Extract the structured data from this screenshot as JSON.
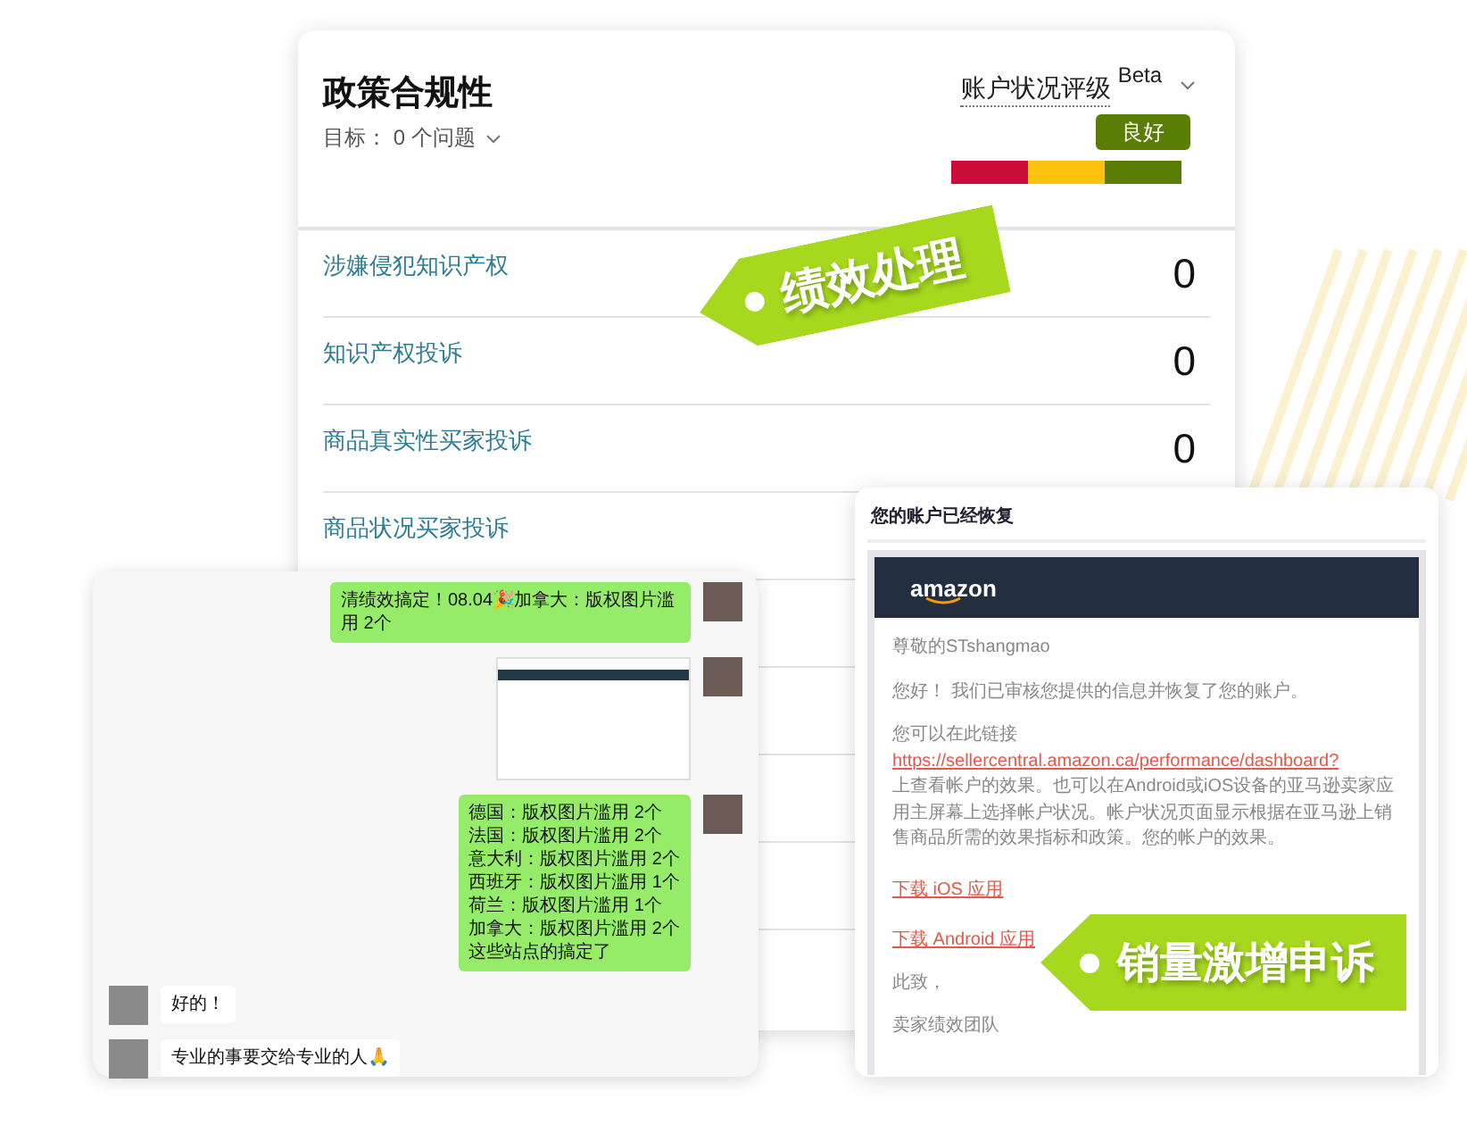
{
  "compliance": {
    "title": "政策合规性",
    "goal": "目标： 0 个问题",
    "rating_label": "账户状况评级",
    "badge": "Beta",
    "status": "良好",
    "gauge": [
      {
        "color": "#cc0c39",
        "selected": false
      },
      {
        "color": "#ffc20e",
        "selected": false
      },
      {
        "color": "#5a7d04",
        "selected": true
      }
    ],
    "rows": [
      {
        "label": "涉嫌侵犯知识产权",
        "count": "0"
      },
      {
        "label": "知识产权投诉",
        "count": "0"
      },
      {
        "label": "商品真实性买家投诉",
        "count": "0"
      },
      {
        "label": "商品状况买家投诉"
      }
    ]
  },
  "chat": {
    "messages": [
      {
        "kind": "sent",
        "text": "清绩效搞定！08.04🎉加拿大：版权图片滥用 2个"
      },
      {
        "kind": "image"
      },
      {
        "kind": "sent",
        "lines": [
          "德国：版权图片滥用 2个",
          "法国：版权图片滥用 2个",
          "意大利：版权图片滥用 2个",
          "西班牙：版权图片滥用 1个",
          "荷兰：版权图片滥用 1个",
          "加拿大：版权图片滥用 2个",
          "这些站点的搞定了"
        ]
      },
      {
        "kind": "received",
        "text": "好的！"
      },
      {
        "kind": "received",
        "text": "专业的事要交给专业的人🙏"
      }
    ]
  },
  "email": {
    "title": "您的账户已经恢复",
    "logo": "amazon",
    "greeting": "尊敬的STshangmao",
    "intro": "您好！ 我们已审核您提供的信息并恢复了您的账户。",
    "body_before_link": "您可以在此链接",
    "link": "https://sellercentral.amazon.ca/performance/dashboard?",
    "body_after_link": "上查看帐户的效果。也可以在Android或iOS设备的亚马逊卖家应用主屏幕上选择帐户状况。帐户状况页面显示根据在亚马逊上销售商品所需的效果指标和政策。您的帐户的效果。",
    "downloads": [
      "下载 iOS 应用",
      "下载 Android 应用"
    ],
    "closing": "此致，",
    "signature": "卖家绩效团队"
  },
  "tags": [
    {
      "kind": "performance",
      "text": "绩效处理"
    },
    {
      "kind": "appeal",
      "text": "销量激增申诉"
    }
  ]
}
